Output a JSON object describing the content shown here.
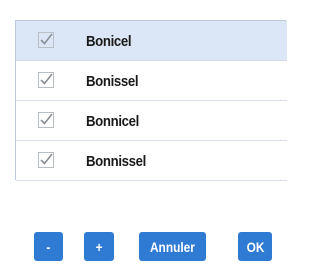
{
  "list": {
    "items": [
      {
        "label": "Bonicel",
        "checked": true,
        "selected": true
      },
      {
        "label": "Bonissel",
        "checked": true,
        "selected": false
      },
      {
        "label": "Bonnicel",
        "checked": true,
        "selected": false
      },
      {
        "label": "Bonnissel",
        "checked": true,
        "selected": false
      }
    ]
  },
  "buttons": {
    "minus_label": "-",
    "plus_label": "+",
    "cancel_label": "Annuler",
    "ok_label": "OK"
  },
  "colors": {
    "accent": "#2f7bd3",
    "selected_row": "#dbe6f6",
    "checkmark": "#8a8f96"
  }
}
